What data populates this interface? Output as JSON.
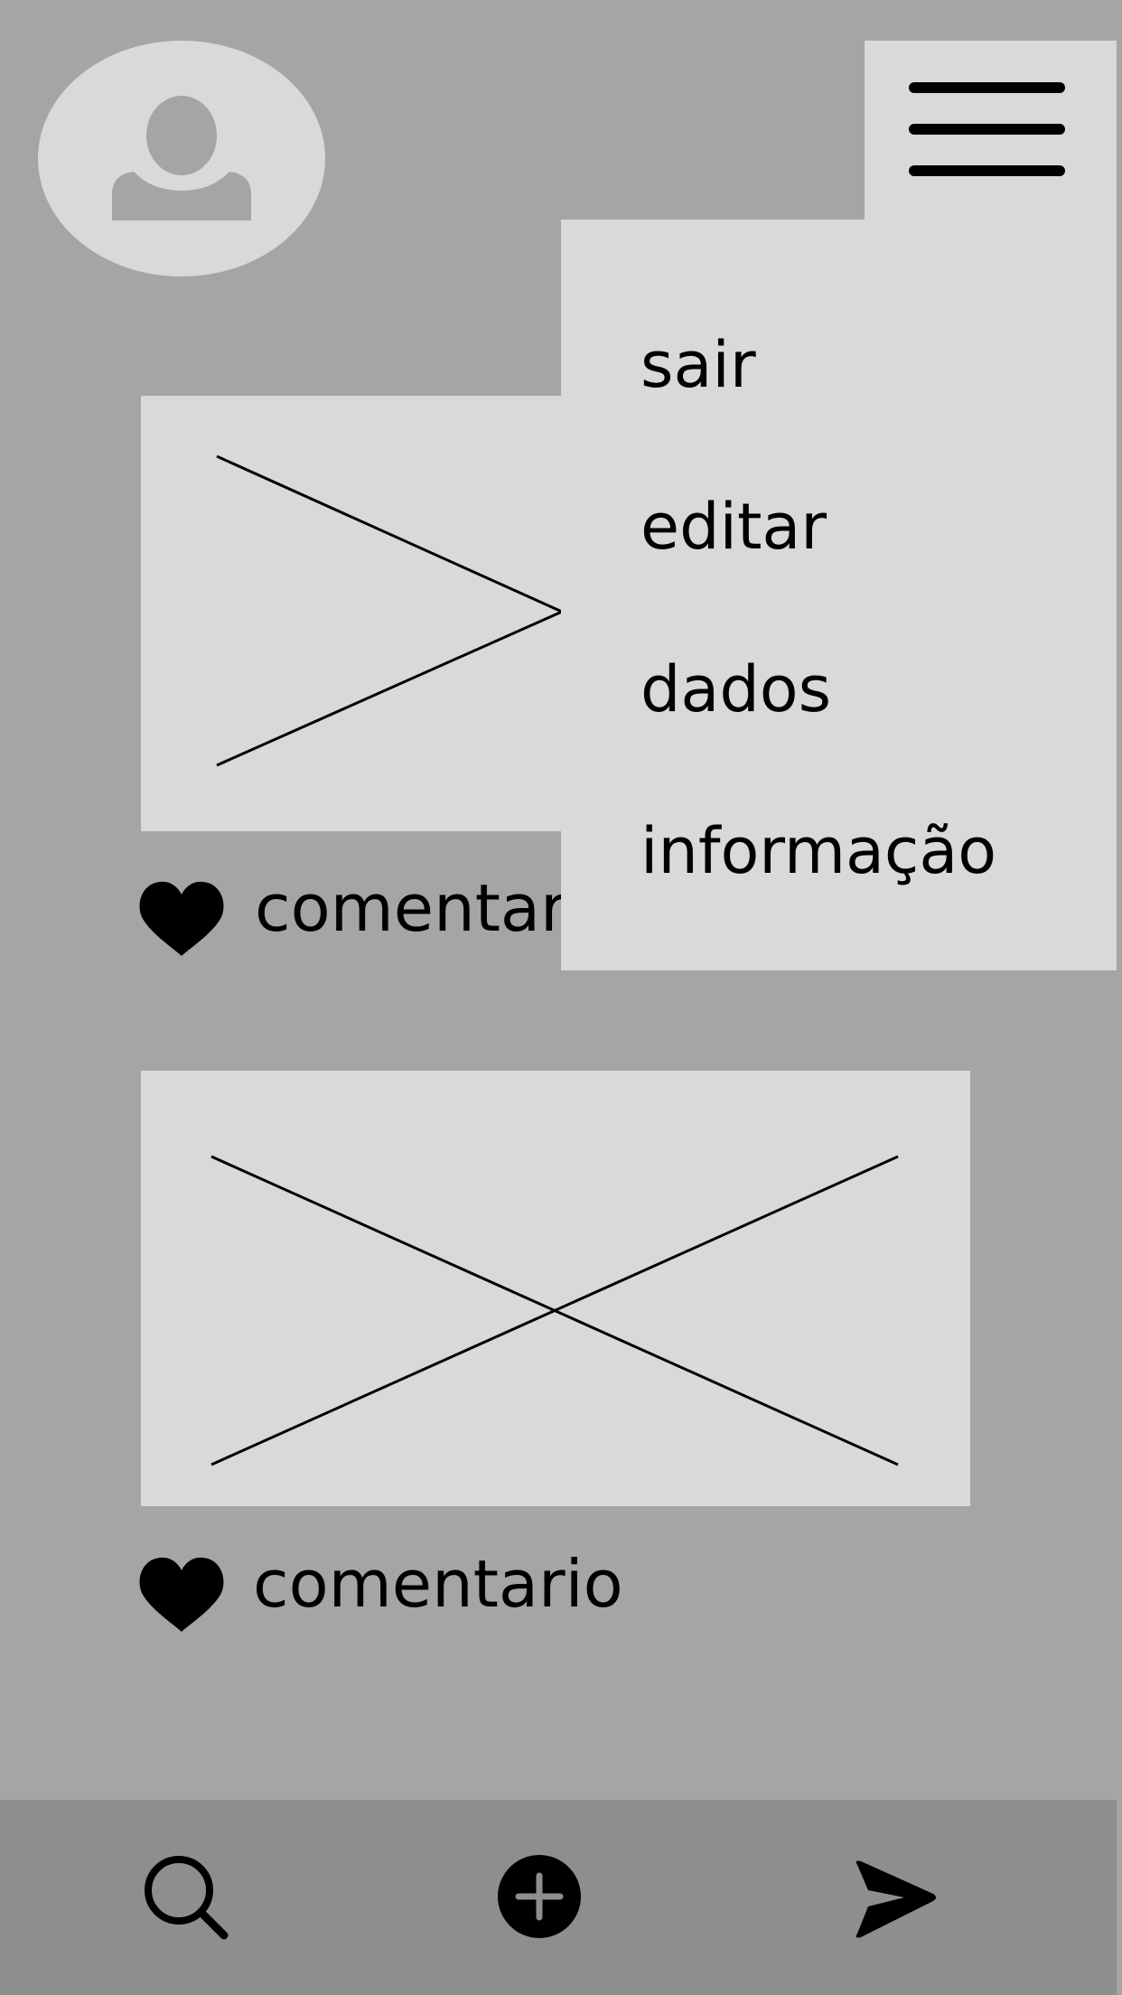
{
  "colors": {
    "background": "#a6a4a5",
    "panel": "#d9d9d9",
    "bottom_nav": "#8f8e8f",
    "ink": "#000000"
  },
  "header": {
    "avatar_icon": "user-icon",
    "menu_icon": "hamburger-icon"
  },
  "dropdown": {
    "items": [
      "sair",
      "editar",
      "dados",
      "informação"
    ]
  },
  "feed": {
    "posts": [
      {
        "image": "image-placeholder",
        "like_icon": "heart-icon",
        "comment_label": "comentar"
      },
      {
        "image": "image-placeholder",
        "like_icon": "heart-icon",
        "comment_label": "comentario"
      }
    ]
  },
  "bottom_nav": {
    "items": [
      {
        "icon": "search-icon"
      },
      {
        "icon": "plus-circle-icon"
      },
      {
        "icon": "send-icon"
      }
    ]
  }
}
